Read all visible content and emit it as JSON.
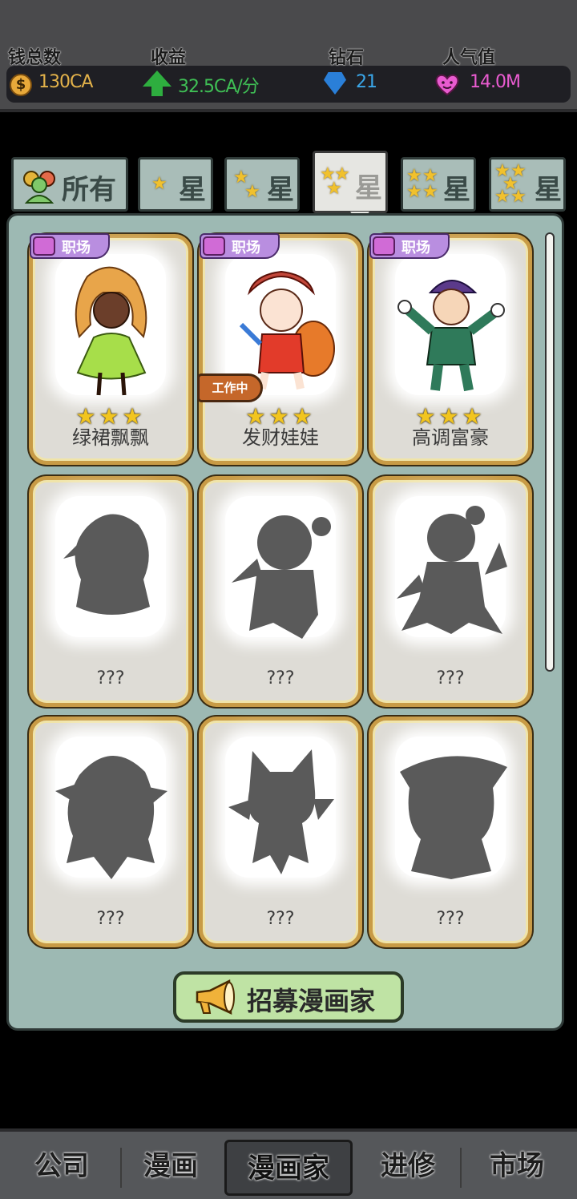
{
  "stats": [
    {
      "label": "钱总数",
      "value": "130CA",
      "icon": "coin-icon",
      "color": "#e3b24a"
    },
    {
      "label": "收益",
      "value": "32.5CA/分",
      "icon": "arrow-up-icon",
      "color": "#3fbf55"
    },
    {
      "label": "钻石",
      "value": "21",
      "icon": "diamond-icon",
      "color": "#3aa6e8"
    },
    {
      "label": "人气值",
      "value": "14.0M",
      "icon": "heart-icon",
      "color": "#e95bd0"
    }
  ],
  "tabs": [
    {
      "label": "所有",
      "stars": 0
    },
    {
      "label": "星",
      "stars": 1
    },
    {
      "label": "星",
      "stars": 2
    },
    {
      "label": "星",
      "stars": 3,
      "active": true
    },
    {
      "label": "星",
      "stars": 4
    },
    {
      "label": "星",
      "stars": 5
    }
  ],
  "cards": [
    {
      "name": "绿裙飘飘",
      "tag": "职场",
      "stars": "★★★",
      "unlocked": true
    },
    {
      "name": "发财娃娃",
      "tag": "职场",
      "stars": "★★★",
      "unlocked": true,
      "status": "工作中"
    },
    {
      "name": "高调富豪",
      "tag": "职场",
      "stars": "★★★",
      "unlocked": true
    },
    {
      "name": "???",
      "unlocked": false
    },
    {
      "name": "???",
      "unlocked": false
    },
    {
      "name": "???",
      "unlocked": false
    },
    {
      "name": "???",
      "unlocked": false
    },
    {
      "name": "???",
      "unlocked": false
    },
    {
      "name": "???",
      "unlocked": false
    }
  ],
  "recruit_label": "招募漫画家",
  "nav": [
    "公司",
    "漫画",
    "漫画家",
    "进修",
    "市场"
  ],
  "nav_active": "漫画家"
}
